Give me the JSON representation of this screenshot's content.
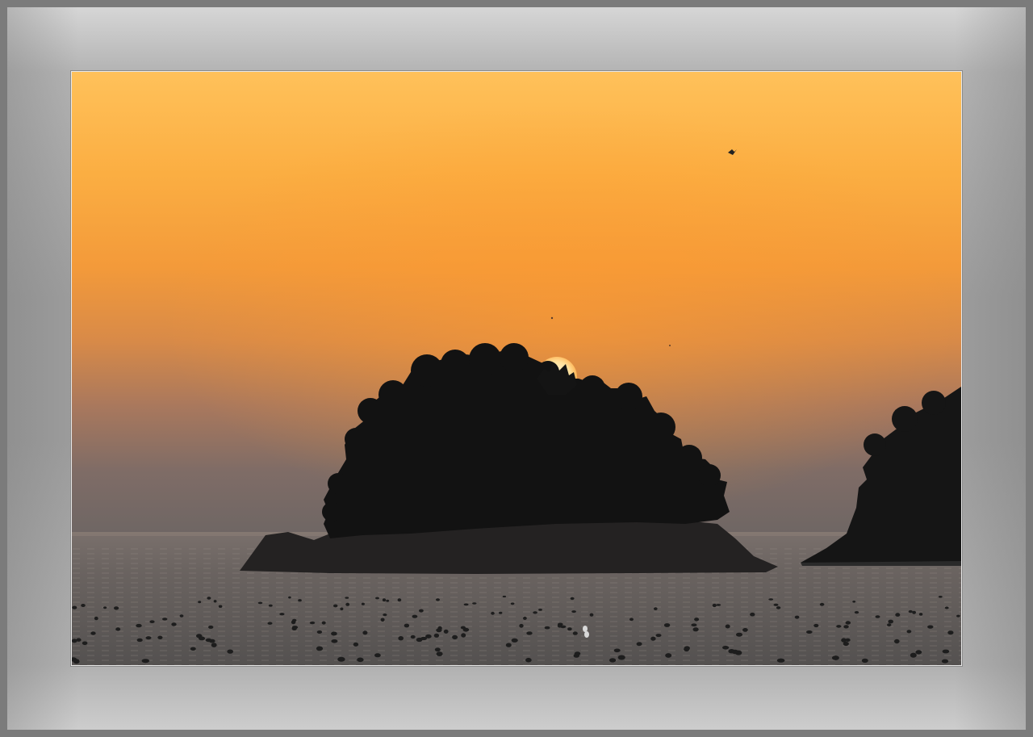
{
  "photo": {
    "subject": "",
    "colors": {
      "sky_top": "#ffc057",
      "sky_mid": "#f9a23a",
      "sky_low": "#b7774f",
      "haze": "#7d6a62",
      "sea": "#5b5856",
      "sun": "#ffe9b0",
      "silhouette": "#141414",
      "mat": "#a4a4a4",
      "frame": "#7b7b7b"
    }
  }
}
